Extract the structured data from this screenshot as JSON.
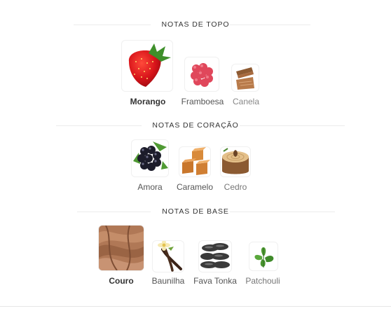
{
  "sections": [
    {
      "title": "NOTAS DE TOPO",
      "notes": [
        {
          "name": "Morango",
          "icon": "strawberry-icon",
          "emphasis": "primary"
        },
        {
          "name": "Framboesa",
          "icon": "raspberry-icon",
          "emphasis": "secondary"
        },
        {
          "name": "Canela",
          "icon": "cinnamon-icon",
          "emphasis": "tertiary"
        }
      ]
    },
    {
      "title": "NOTAS DE CORAÇÃO",
      "notes": [
        {
          "name": "Amora",
          "icon": "blackberry-icon",
          "emphasis": "secondary"
        },
        {
          "name": "Caramelo",
          "icon": "caramel-icon",
          "emphasis": "secondary"
        },
        {
          "name": "Cedro",
          "icon": "cedar-icon",
          "emphasis": "tertiary"
        }
      ]
    },
    {
      "title": "NOTAS DE BASE",
      "notes": [
        {
          "name": "Couro",
          "icon": "leather-icon",
          "emphasis": "primary"
        },
        {
          "name": "Baunilha",
          "icon": "vanilla-icon",
          "emphasis": "secondary"
        },
        {
          "name": "Fava Tonka",
          "icon": "tonka-bean-icon",
          "emphasis": "secondary"
        },
        {
          "name": "Patchouli",
          "icon": "patchouli-icon",
          "emphasis": "tertiary"
        }
      ]
    }
  ],
  "colors": {
    "label_primary": "#333333",
    "label_secondary": "#555555",
    "label_tertiary": "#888888",
    "divider": "#ececec"
  }
}
